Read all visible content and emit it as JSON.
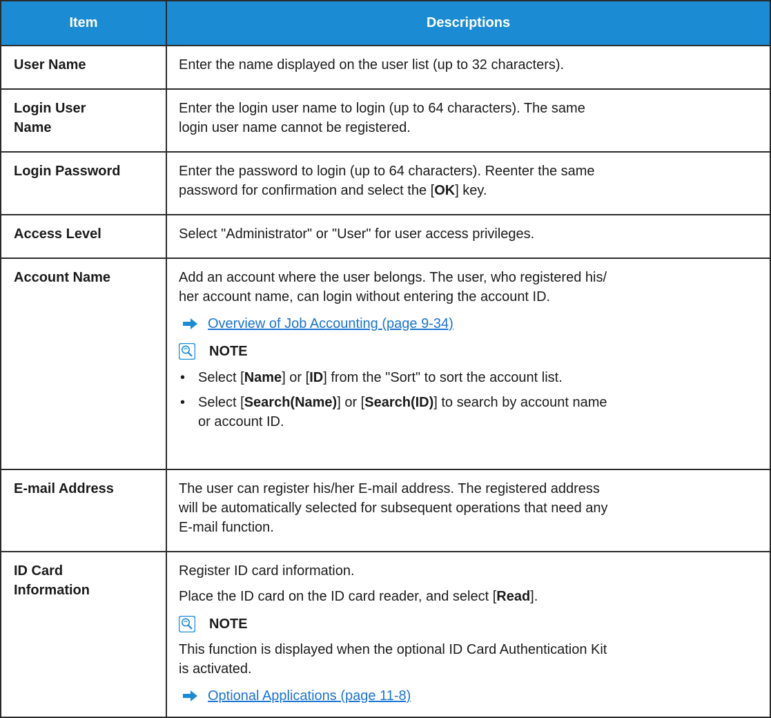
{
  "header": {
    "item": "Item",
    "descriptions": "Descriptions"
  },
  "rows": [
    {
      "item": "User Name",
      "text": "Enter the name displayed on the user list (up to 32 characters)."
    },
    {
      "item_line1": "Login User",
      "item_line2": "Name",
      "line1": "Enter the login user name to login (up to 64 characters). The same",
      "line2": "login user name cannot be registered."
    },
    {
      "item": "Login Password",
      "line1": "Enter the password to login (up to 64 characters). Reenter the same",
      "line2_pre": "password for confirmation and select the [",
      "key": "OK",
      "line2_post": "] key."
    },
    {
      "item": "Access Level",
      "text": "Select \"Administrator\" or \"User\" for user access privileges."
    },
    {
      "item": "Account Name",
      "line1": "Add an account where the user belongs. The user, who registered his/",
      "line2": "her account name, can login without entering the account ID.",
      "link": "Overview of Job Accounting (page 9-34)",
      "note": "NOTE",
      "bullet_char": "•",
      "bullet1": {
        "pre": "Select [",
        "k1": "Name",
        "mid": "] or [",
        "k2": "ID",
        "post": "] from the \"Sort\" to sort the account list."
      },
      "bullet2": {
        "pre": "Select [",
        "k1": "Search(Name)",
        "mid": "] or [",
        "k2": "Search(ID)",
        "post_line1": "] to search by account name",
        "post_line2": "or account ID."
      }
    },
    {
      "item": "E-mail Address",
      "line1": "The user can register his/her E-mail address. The registered address",
      "line2": "will be automatically selected for subsequent operations that need any",
      "line3": "E-mail function."
    },
    {
      "item_line1": "ID Card",
      "item_line2": "Information",
      "line1": "Register ID card information.",
      "line2_pre": "Place the ID card on the ID card reader, and select [",
      "key": "Read",
      "line2_post": "].",
      "note": "NOTE",
      "note_line1": "This function is displayed when the optional ID Card Authentication Kit",
      "note_line2": "is activated.",
      "link": "Optional Applications (page 11-8)"
    }
  ],
  "colors": {
    "header_bg": "#1b8bd3",
    "link": "#1a73d1",
    "arrow": "#1b8bd3"
  },
  "icons": {
    "link_arrow": "arrow-right-icon",
    "note": "lightbulb-note-icon"
  }
}
